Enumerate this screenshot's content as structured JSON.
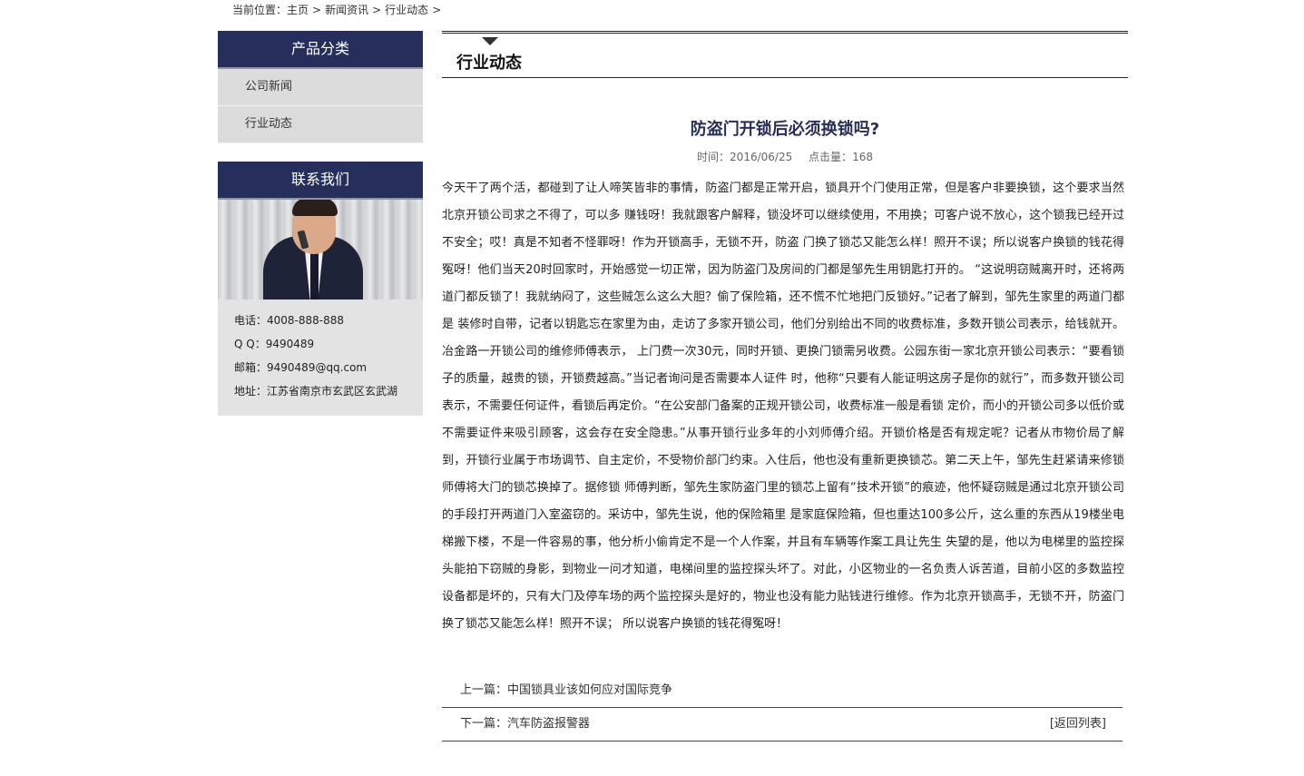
{
  "breadcrumb": {
    "prefix": "当前位置：",
    "items": [
      "主页",
      "新闻资讯",
      "行业动态"
    ],
    "sep": ">"
  },
  "sidebar": {
    "categories_title": "产品分类",
    "categories": [
      {
        "label": "公司新闻"
      },
      {
        "label": "行业动态"
      }
    ],
    "contact_title": "联系我们",
    "contact": {
      "phone": "电话：4008-888-888",
      "qq": "Q Q：9490489",
      "email": "邮箱：9490489@qq.com",
      "address": "地址：江苏省南京市玄武区玄武湖"
    }
  },
  "main": {
    "section_title": "行业动态",
    "article": {
      "title": "防盗门开锁后必须换锁吗?",
      "time_label": "时间：",
      "time": "2016/06/25",
      "hits_label": "点击量：",
      "hits": "168",
      "body": "今天干了两个活，都碰到了让人啼笑皆非的事情，防盗门都是正常开启，锁具开个门使用正常，但是客户非要换锁，这个要求当然北京开锁公司求之不得了，可以多 赚钱呀！我就跟客户解释，锁没坏可以继续使用，不用换；可客户说不放心，这个锁我已经开过不安全；哎！真是不知者不怪罪呀！作为开锁高手，无锁不开，防盗 门换了锁芯又能怎么样！照开不误；所以说客户换锁的钱花得冤呀！他们当天20时回家时，开始感觉一切正常，因为防盗门及房间的门都是邹先生用钥匙打开的。 “这说明窃贼离开时，还将两道门都反锁了！我就纳闷了，这些贼怎么这么大胆？偷了保险箱，还不慌不忙地把门反锁好。”记者了解到，邹先生家里的两道门都是 装修时自带，记者以钥匙忘在家里为由，走访了多家开锁公司，他们分别给出不同的收费标准，多数开锁公司表示，给钱就开。冶金路一开锁公司的维修师傅表示， 上门费一次30元，同时开锁、更换门锁需另收费。公园东街一家北京开锁公司表示：“要看锁子的质量，越贵的锁，开锁费越高。”当记者询问是否需要本人证件 时，他称“只要有人能证明这房子是你的就行”，而多数开锁公司表示，不需要任何证件，看锁后再定价。“在公安部门备案的正规开锁公司，收费标准一般是看锁 定价，而小的开锁公司多以低价或不需要证件来吸引顾客，这会存在安全隐患。”从事开锁行业多年的小刘师傅介绍。开锁价格是否有规定呢？记者从市物价局了解 到，开锁行业属于市场调节、自主定价，不受物价部门约束。入住后，他也没有重新更换锁芯。第二天上午，邹先生赶紧请来修锁师傅将大门的锁芯换掉了。据修锁 师傅判断，邹先生家防盗门里的锁芯上留有“技术开锁”的痕迹，他怀疑窃贼是通过北京开锁公司的手段打开两道门入室盗窃的。采访中，邹先生说，他的保险箱里 是家庭保险箱，但也重达100多公斤，这么重的东西从19楼坐电梯搬下楼，不是一件容易的事，他分析小偷肯定不是一个人作案，并且有车辆等作案工具让先生 失望的是，他以为电梯里的监控探头能拍下窃贼的身影，到物业一问才知道，电梯间里的监控探头坏了。对此，小区物业的一名负责人诉苦道，目前小区的多数监控 设备都是坏的，只有大门及停车场的两个监控探头是好的，物业也没有能力贴钱进行维修。作为北京开锁高手，无锁不开，防盗门换了锁芯又能怎么样！照开不误； 所以说客户换锁的钱花得冤呀！"
    },
    "prev_label": "上一篇：",
    "prev_title": "中国锁具业该如何应对国际竞争",
    "next_label": "下一篇：",
    "next_title": "汽车防盗报警器",
    "back_label": "[返回列表]"
  },
  "colors": {
    "panel_header": "#262e5b",
    "sidebar_item_bg": "#dcdcdc",
    "contact_bg": "#e3e3e3"
  }
}
